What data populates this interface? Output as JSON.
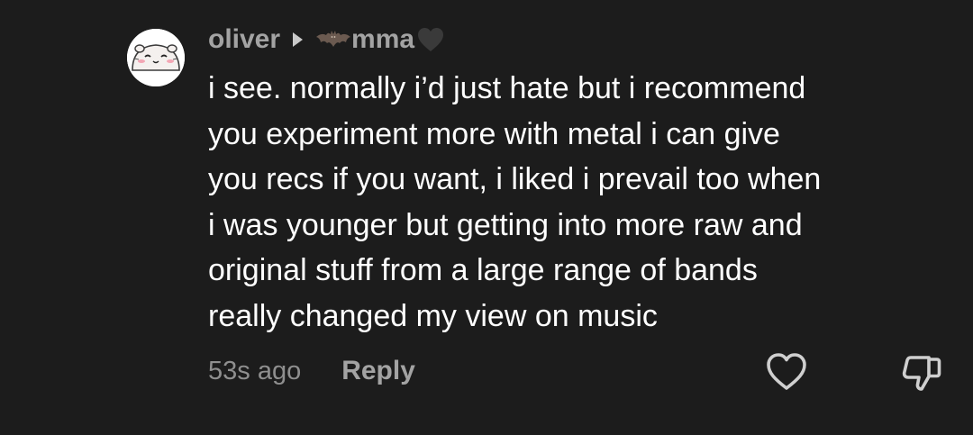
{
  "comment": {
    "author": "oliver",
    "replied_to": "mma",
    "body_lines": [
      "i see. normally i’d just hate but i recommend",
      "you experiment more with metal i can give",
      "you recs if you want, i liked i prevail too when",
      "i was younger but getting into more raw and",
      "original stuff from a large range of bands",
      "really changed my view on music"
    ],
    "timestamp": "53s ago",
    "reply_label": "Reply"
  },
  "icons": {
    "avatar": "cartoon-hamster-avatar",
    "reply_indicator": "triangle-right-icon",
    "emoji_before_name": "bat-emoji",
    "emoji_after_name": "black-heart-emoji",
    "like": "heart-outline-icon",
    "dislike": "thumbs-down-outline-icon"
  },
  "colors": {
    "background": "#1c1c1c",
    "text_primary": "#ffffff",
    "text_secondary": "#a3a3a3",
    "text_muted": "#8f8f8f"
  }
}
